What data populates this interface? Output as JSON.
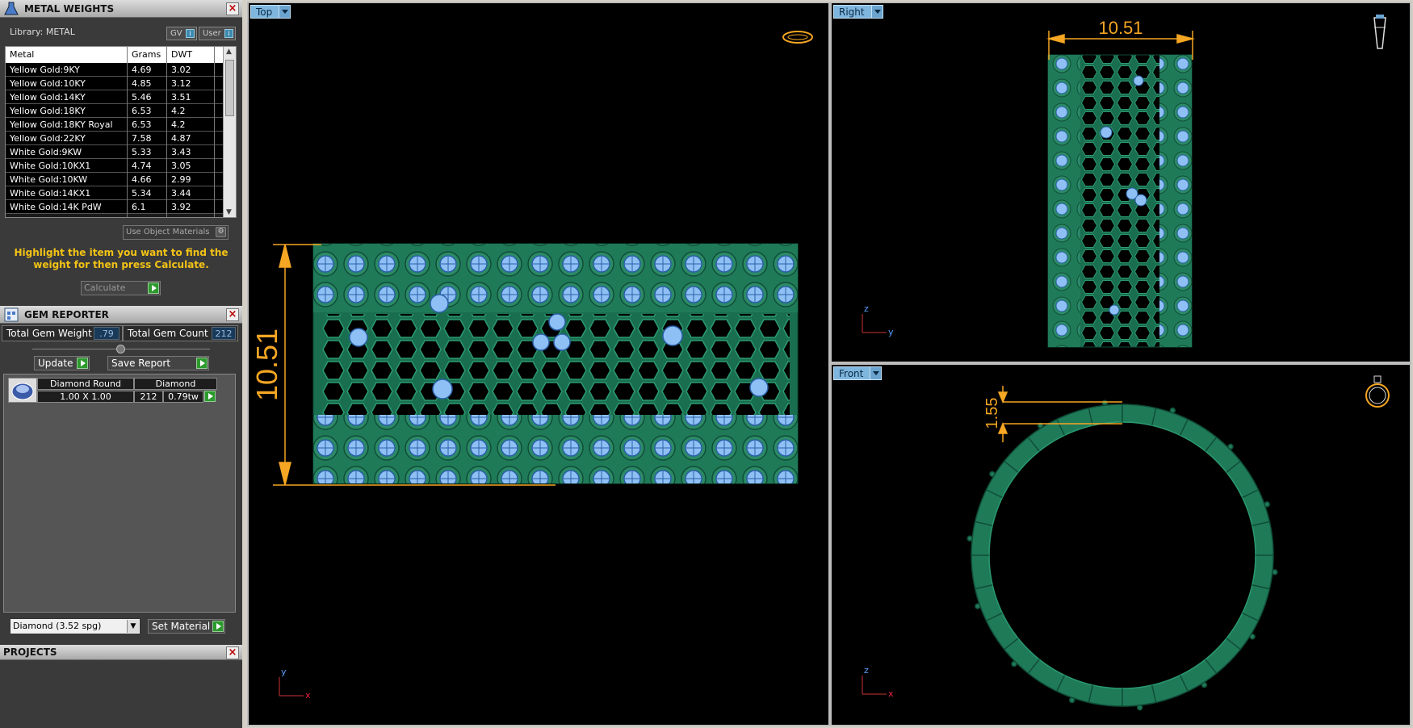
{
  "metal_weights": {
    "title": "METAL WEIGHTS",
    "library_label": "Library: METAL",
    "gv_label": "GV",
    "user_label": "User",
    "columns": [
      "Metal",
      "Grams",
      "DWT"
    ],
    "rows": [
      [
        "Yellow Gold:9KY",
        "4.69",
        "3.02"
      ],
      [
        "Yellow Gold:10KY",
        "4.85",
        "3.12"
      ],
      [
        "Yellow Gold:14KY",
        "5.46",
        "3.51"
      ],
      [
        "Yellow Gold:18KY",
        "6.53",
        "4.2"
      ],
      [
        "Yellow Gold:18KY Royal",
        "6.53",
        "4.2"
      ],
      [
        "Yellow Gold:22KY",
        "7.58",
        "4.87"
      ],
      [
        "White Gold:9KW",
        "5.33",
        "3.43"
      ],
      [
        "White Gold:10KX1",
        "4.74",
        "3.05"
      ],
      [
        "White Gold:10KW",
        "4.66",
        "2.99"
      ],
      [
        "White Gold:14KX1",
        "5.34",
        "3.44"
      ],
      [
        "White Gold:14K PdW",
        "6.1",
        "3.92"
      ]
    ],
    "use_object_materials": "Use Object Materials",
    "hint": "Highlight the item you want to find the weight for then press Calculate.",
    "calculate_label": "Calculate"
  },
  "gem_reporter": {
    "title": "GEM REPORTER",
    "total_weight_label": "Total Gem Weight",
    "total_weight_value": ".79",
    "total_count_label": "Total Gem Count",
    "total_count_value": "212",
    "update_label": "Update",
    "save_report_label": "Save Report",
    "gem": {
      "header_shape": "Diamond Round",
      "header_material": "Diamond",
      "size": "1.00 X 1.00",
      "count": "212",
      "weight": "0.79tw"
    },
    "material_select": "Diamond    (3.52 spg)",
    "set_material_label": "Set Material"
  },
  "projects": {
    "title": "PROJECTS"
  },
  "viewports": {
    "top": {
      "label": "Top",
      "dimension": "10.51",
      "axis_v": "y",
      "axis_h": "x"
    },
    "right": {
      "label": "Right",
      "dimension": "10.51",
      "axis_v": "z",
      "axis_h": "y"
    },
    "front": {
      "label": "Front",
      "dimension": "1.55",
      "axis_v": "z",
      "axis_h": "x"
    }
  },
  "colors": {
    "metal": "#1e7a58",
    "metal_dark": "#0f4d37",
    "gem": "#7fb3ee",
    "dimension": "#f5a623"
  }
}
